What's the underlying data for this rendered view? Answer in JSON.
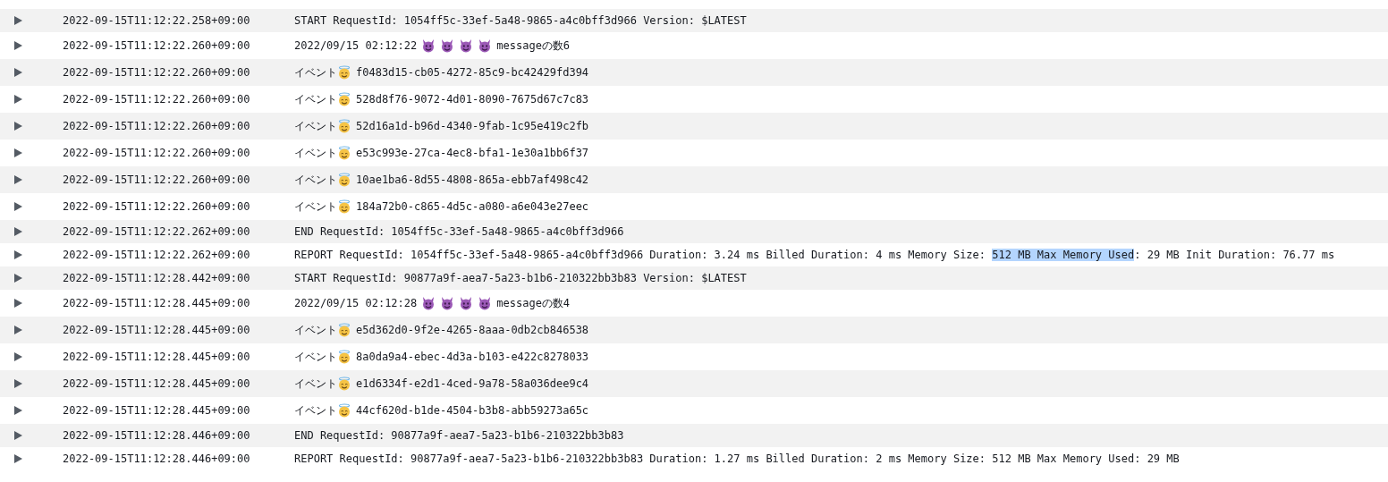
{
  "rows": [
    {
      "timestamp": "2022-09-15T11:12:22.258+09:00",
      "parts": [
        {
          "kind": "text",
          "text": "START RequestId: 1054ff5c-33ef-5a48-9865-a4c0bff3d966 Version: $LATEST"
        }
      ]
    },
    {
      "timestamp": "2022-09-15T11:12:22.260+09:00",
      "parts": [
        {
          "kind": "text",
          "text": "2022/09/15 02:12:22"
        },
        {
          "kind": "devil"
        },
        {
          "kind": "devil"
        },
        {
          "kind": "devil"
        },
        {
          "kind": "devil"
        },
        {
          "kind": "text",
          "text": "messageの数6"
        }
      ]
    },
    {
      "timestamp": "2022-09-15T11:12:22.260+09:00",
      "parts": [
        {
          "kind": "text",
          "text": "イベント"
        },
        {
          "kind": "halo"
        },
        {
          "kind": "text",
          "text": "f0483d15-cb05-4272-85c9-bc42429fd394"
        }
      ]
    },
    {
      "timestamp": "2022-09-15T11:12:22.260+09:00",
      "parts": [
        {
          "kind": "text",
          "text": "イベント"
        },
        {
          "kind": "halo"
        },
        {
          "kind": "text",
          "text": "528d8f76-9072-4d01-8090-7675d67c7c83"
        }
      ]
    },
    {
      "timestamp": "2022-09-15T11:12:22.260+09:00",
      "parts": [
        {
          "kind": "text",
          "text": "イベント"
        },
        {
          "kind": "halo"
        },
        {
          "kind": "text",
          "text": "52d16a1d-b96d-4340-9fab-1c95e419c2fb"
        }
      ]
    },
    {
      "timestamp": "2022-09-15T11:12:22.260+09:00",
      "parts": [
        {
          "kind": "text",
          "text": "イベント"
        },
        {
          "kind": "halo"
        },
        {
          "kind": "text",
          "text": "e53c993e-27ca-4ec8-bfa1-1e30a1bb6f37"
        }
      ]
    },
    {
      "timestamp": "2022-09-15T11:12:22.260+09:00",
      "parts": [
        {
          "kind": "text",
          "text": "イベント"
        },
        {
          "kind": "halo"
        },
        {
          "kind": "text",
          "text": "10ae1ba6-8d55-4808-865a-ebb7af498c42"
        }
      ]
    },
    {
      "timestamp": "2022-09-15T11:12:22.260+09:00",
      "parts": [
        {
          "kind": "text",
          "text": "イベント"
        },
        {
          "kind": "halo"
        },
        {
          "kind": "text",
          "text": "184a72b0-c865-4d5c-a080-a6e043e27eec"
        }
      ]
    },
    {
      "timestamp": "2022-09-15T11:12:22.262+09:00",
      "parts": [
        {
          "kind": "text",
          "text": "END RequestId: 1054ff5c-33ef-5a48-9865-a4c0bff3d966"
        }
      ]
    },
    {
      "timestamp": "2022-09-15T11:12:22.262+09:00",
      "parts": [
        {
          "kind": "text",
          "segments": [
            {
              "text": "REPORT RequestId: 1054ff5c-33ef-5a48-9865-a4c0bff3d966 Duration: 3.24 ms Billed Duration: 4 ms Memory Size: ",
              "highlighted": false
            },
            {
              "text": "512 MB Max Memory Used",
              "highlighted": true
            },
            {
              "text": ": 29 MB Init Duration: 76.77 ms",
              "highlighted": false
            }
          ]
        }
      ]
    },
    {
      "timestamp": "2022-09-15T11:12:28.442+09:00",
      "parts": [
        {
          "kind": "text",
          "text": "START RequestId: 90877a9f-aea7-5a23-b1b6-210322bb3b83 Version: $LATEST"
        }
      ]
    },
    {
      "timestamp": "2022-09-15T11:12:28.445+09:00",
      "parts": [
        {
          "kind": "text",
          "text": "2022/09/15 02:12:28"
        },
        {
          "kind": "devil"
        },
        {
          "kind": "devil"
        },
        {
          "kind": "devil"
        },
        {
          "kind": "devil"
        },
        {
          "kind": "text",
          "text": "messageの数4"
        }
      ]
    },
    {
      "timestamp": "2022-09-15T11:12:28.445+09:00",
      "parts": [
        {
          "kind": "text",
          "text": "イベント"
        },
        {
          "kind": "halo"
        },
        {
          "kind": "text",
          "text": "e5d362d0-9f2e-4265-8aaa-0db2cb846538"
        }
      ]
    },
    {
      "timestamp": "2022-09-15T11:12:28.445+09:00",
      "parts": [
        {
          "kind": "text",
          "text": "イベント"
        },
        {
          "kind": "halo"
        },
        {
          "kind": "text",
          "text": "8a0da9a4-ebec-4d3a-b103-e422c8278033"
        }
      ]
    },
    {
      "timestamp": "2022-09-15T11:12:28.445+09:00",
      "parts": [
        {
          "kind": "text",
          "text": "イベント"
        },
        {
          "kind": "halo"
        },
        {
          "kind": "text",
          "text": "e1d6334f-e2d1-4ced-9a78-58a036dee9c4"
        }
      ]
    },
    {
      "timestamp": "2022-09-15T11:12:28.445+09:00",
      "parts": [
        {
          "kind": "text",
          "text": "イベント"
        },
        {
          "kind": "halo"
        },
        {
          "kind": "text",
          "text": "44cf620d-b1de-4504-b3b8-abb59273a65c"
        }
      ]
    },
    {
      "timestamp": "2022-09-15T11:12:28.446+09:00",
      "parts": [
        {
          "kind": "text",
          "text": "END RequestId: 90877a9f-aea7-5a23-b1b6-210322bb3b83"
        }
      ]
    },
    {
      "timestamp": "2022-09-15T11:12:28.446+09:00",
      "parts": [
        {
          "kind": "text",
          "text": "REPORT RequestId: 90877a9f-aea7-5a23-b1b6-210322bb3b83 Duration: 1.27 ms Billed Duration: 2 ms Memory Size: 512 MB Max Memory Used: 29 MB"
        }
      ]
    }
  ]
}
